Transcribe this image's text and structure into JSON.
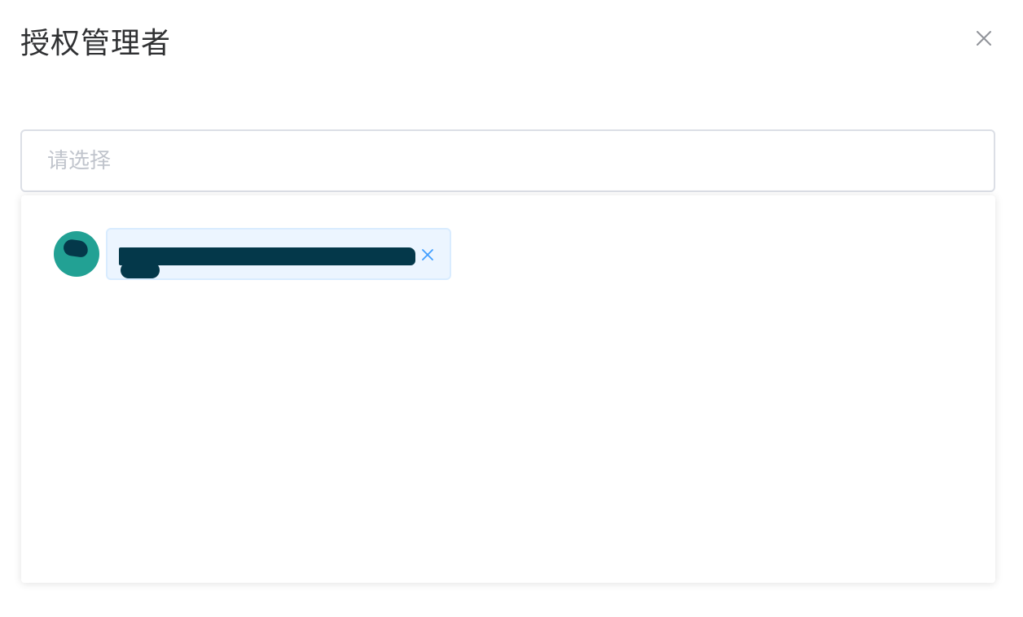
{
  "dialog": {
    "title": "授权管理者",
    "close_icon": "close-icon"
  },
  "select": {
    "placeholder": "请选择",
    "value": ""
  },
  "selected_items": [
    {
      "avatar_initial": "",
      "label": "",
      "remove_icon": "close-icon"
    }
  ],
  "colors": {
    "title_text": "#303133",
    "placeholder": "#c0c4cc",
    "input_border": "#dcdfe6",
    "avatar_bg": "#22a194",
    "tag_bg": "#ecf5ff",
    "tag_border": "#d9ecff",
    "tag_accent": "#409eff",
    "redaction": "#04384a"
  }
}
